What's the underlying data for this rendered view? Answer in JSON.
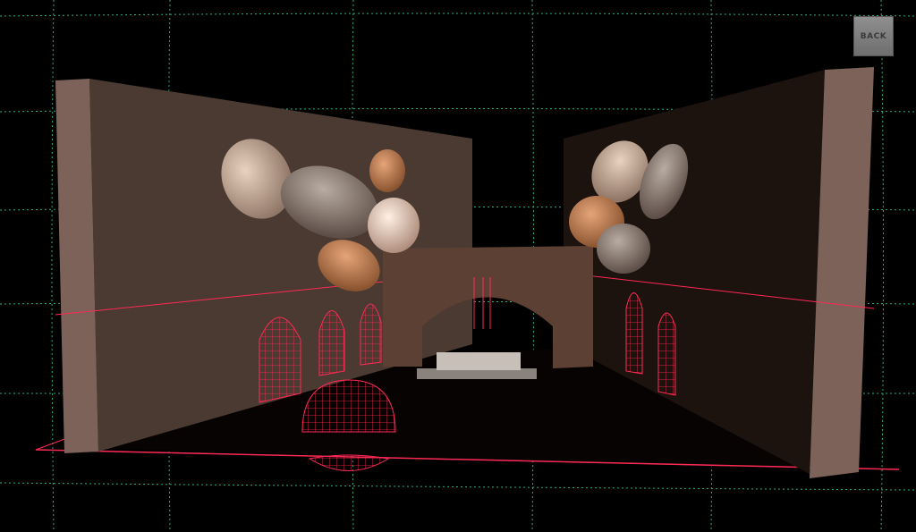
{
  "toolbar": {
    "back_label": "BACK"
  },
  "scene": {
    "background_color": "#000000",
    "grid_color": "#3fd6b0",
    "wireframe_color": "#ff2a55",
    "wall_color": "#4a3a31",
    "wall_edge_color": "#7c6258",
    "arch_color": "#5c4033"
  }
}
